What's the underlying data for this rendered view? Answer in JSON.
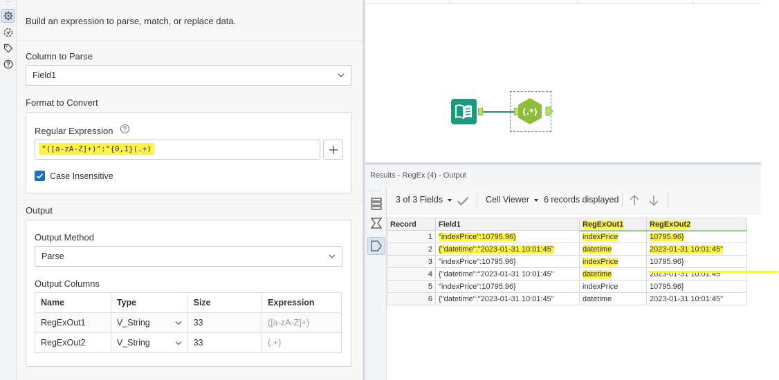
{
  "config": {
    "intro": "Build an expression to parse, match, or replace data.",
    "column_to_parse": {
      "label": "Column to Parse",
      "value": "Field1"
    },
    "format_to_convert": {
      "label": "Format to Convert",
      "regex_label": "Regular Expression",
      "regex_value": "\"([a-zA-Z]+)\":\"{0,1}(.+)",
      "case_insensitive_label": "Case Insensitive",
      "case_insensitive_checked": true
    },
    "output": {
      "label": "Output",
      "method_label": "Output Method",
      "method_value": "Parse",
      "columns_label": "Output Columns",
      "columns_headers": [
        "Name",
        "Type",
        "Size",
        "Expression"
      ],
      "columns_rows": [
        {
          "name": "RegExOut1",
          "type": "V_String",
          "size": "33",
          "expression": "([a-zA-Z]+)"
        },
        {
          "name": "RegExOut2",
          "type": "V_String",
          "size": "33",
          "expression": "(.+)"
        }
      ]
    }
  },
  "rail_icons": [
    "gear-icon",
    "target-icon",
    "tag-icon",
    "help-icon"
  ],
  "canvas": {
    "input_tool_icon": "input-book-icon",
    "regex_tool_label": "(.*)",
    "input_color": "#1a9a7e",
    "regex_color": "#8ebd3a",
    "anchor_color": "#b5e06a"
  },
  "results": {
    "title": "Results - RegEx (4) - Output",
    "toolbar": {
      "fields": "3 of 3 Fields",
      "viewer": "Cell Viewer",
      "records": "6 records displayed"
    },
    "headers": [
      "Record",
      "Field1",
      "RegExOut1",
      "RegExOut2"
    ],
    "rows": [
      {
        "record": "1",
        "field1": "\"indexPrice\":10795.96}",
        "out1": "indexPrice",
        "out2": "10795.96}"
      },
      {
        "record": "2",
        "field1": "{\"datetime\":\"2023-01-31 10:01:45\"",
        "out1": "datetime",
        "out2": "2023-01-31 10:01:45\""
      },
      {
        "record": "3",
        "field1": "\"indexPrice\":10795.96}",
        "out1": "indexPrice",
        "out2": "10795.96}"
      },
      {
        "record": "4",
        "field1": "{\"datetime\":\"2023-01-31 10:01:45\"",
        "out1": "datetime",
        "out2": "2023-01-31 10:01:45\""
      },
      {
        "record": "5",
        "field1": "\"indexPrice\":10795.96}",
        "out1": "indexPrice",
        "out2": "10795.96}"
      },
      {
        "record": "6",
        "field1": "{\"datetime\":\"2023-01-31 10:01:45\"",
        "out1": "datetime",
        "out2": "2023-01-31 10:01:45\""
      }
    ]
  },
  "colors": {
    "highlight": "#fff34a",
    "accent_blue": "#1f6dc4",
    "panel_bg": "#f7f7f8"
  }
}
